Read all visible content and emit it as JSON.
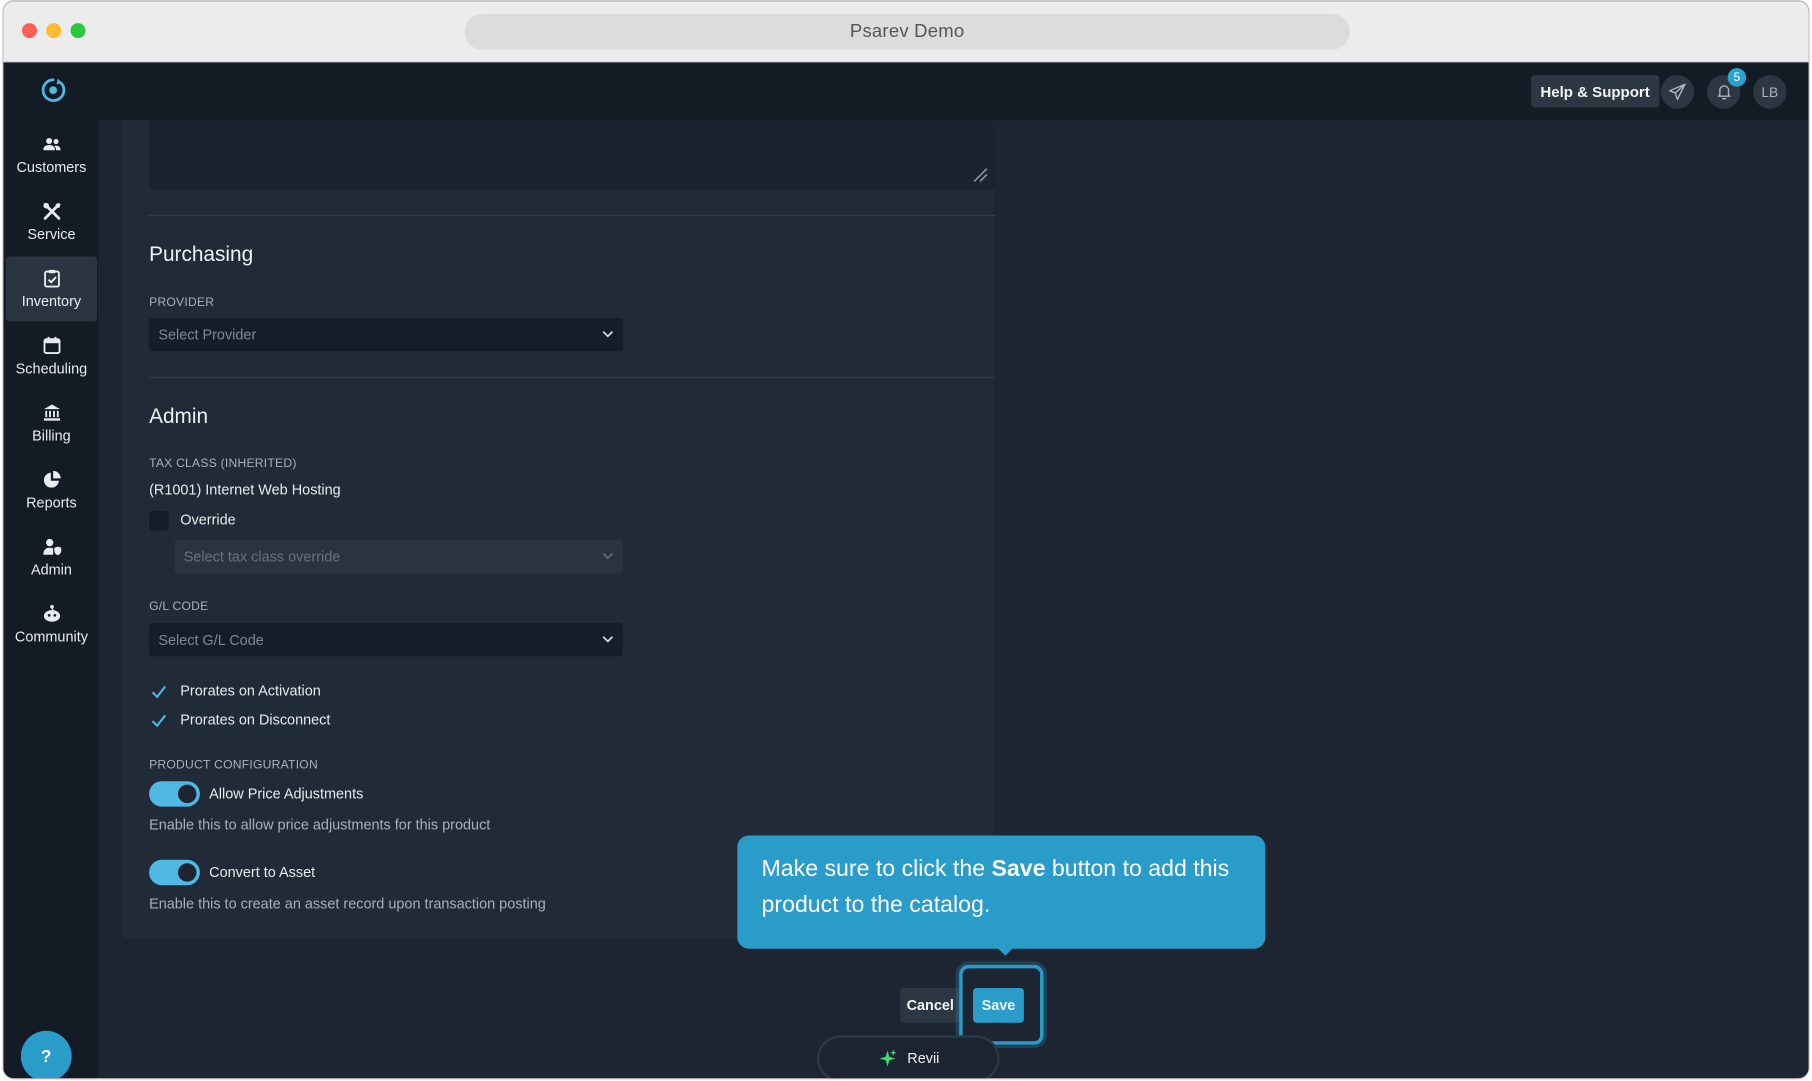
{
  "browser": {
    "title": "Psarev Demo"
  },
  "topbar": {
    "help_label": "Help & Support",
    "notification_count": "5",
    "avatar_initials": "LB"
  },
  "sidebar": {
    "items": [
      {
        "label": "Customers",
        "icon": "users-icon"
      },
      {
        "label": "Service",
        "icon": "tools-icon"
      },
      {
        "label": "Inventory",
        "icon": "clipboard-check-icon",
        "active": true
      },
      {
        "label": "Scheduling",
        "icon": "calendar-icon"
      },
      {
        "label": "Billing",
        "icon": "bank-icon"
      },
      {
        "label": "Reports",
        "icon": "pie-chart-icon"
      },
      {
        "label": "Admin",
        "icon": "user-shield-icon"
      },
      {
        "label": "Community",
        "icon": "community-icon"
      }
    ],
    "help_fab": "?"
  },
  "purchasing": {
    "title": "Purchasing",
    "provider_label": "PROVIDER",
    "provider_placeholder": "Select Provider"
  },
  "admin": {
    "title": "Admin",
    "tax_class_label": "TAX CLASS (INHERITED)",
    "tax_class_value": "(R1001) Internet Web Hosting",
    "override_label": "Override",
    "override_checked": false,
    "tax_override_placeholder": "Select tax class override",
    "gl_label": "G/L CODE",
    "gl_placeholder": "Select G/L Code",
    "prorates_activation_label": "Prorates on Activation",
    "prorates_activation_checked": true,
    "prorates_disconnect_label": "Prorates on Disconnect",
    "prorates_disconnect_checked": true,
    "product_config_label": "PRODUCT CONFIGURATION",
    "allow_price_label": "Allow Price Adjustments",
    "allow_price_on": true,
    "allow_price_help": "Enable this to allow price adjustments for this product",
    "convert_asset_label": "Convert to Asset",
    "convert_asset_on": true,
    "convert_asset_help": "Enable this to create an asset record upon transaction posting"
  },
  "actions": {
    "cancel_label": "Cancel",
    "save_label": "Save"
  },
  "tooltip": {
    "text_before": "Make sure to click the ",
    "text_bold": "Save",
    "text_after": " button to add this product to the catalog."
  },
  "assistant": {
    "label": "Revii"
  },
  "colors": {
    "accent": "#2a9cc9",
    "toggle": "#4fb8e3",
    "background": "#1c2531",
    "sidebar": "#131b25"
  }
}
